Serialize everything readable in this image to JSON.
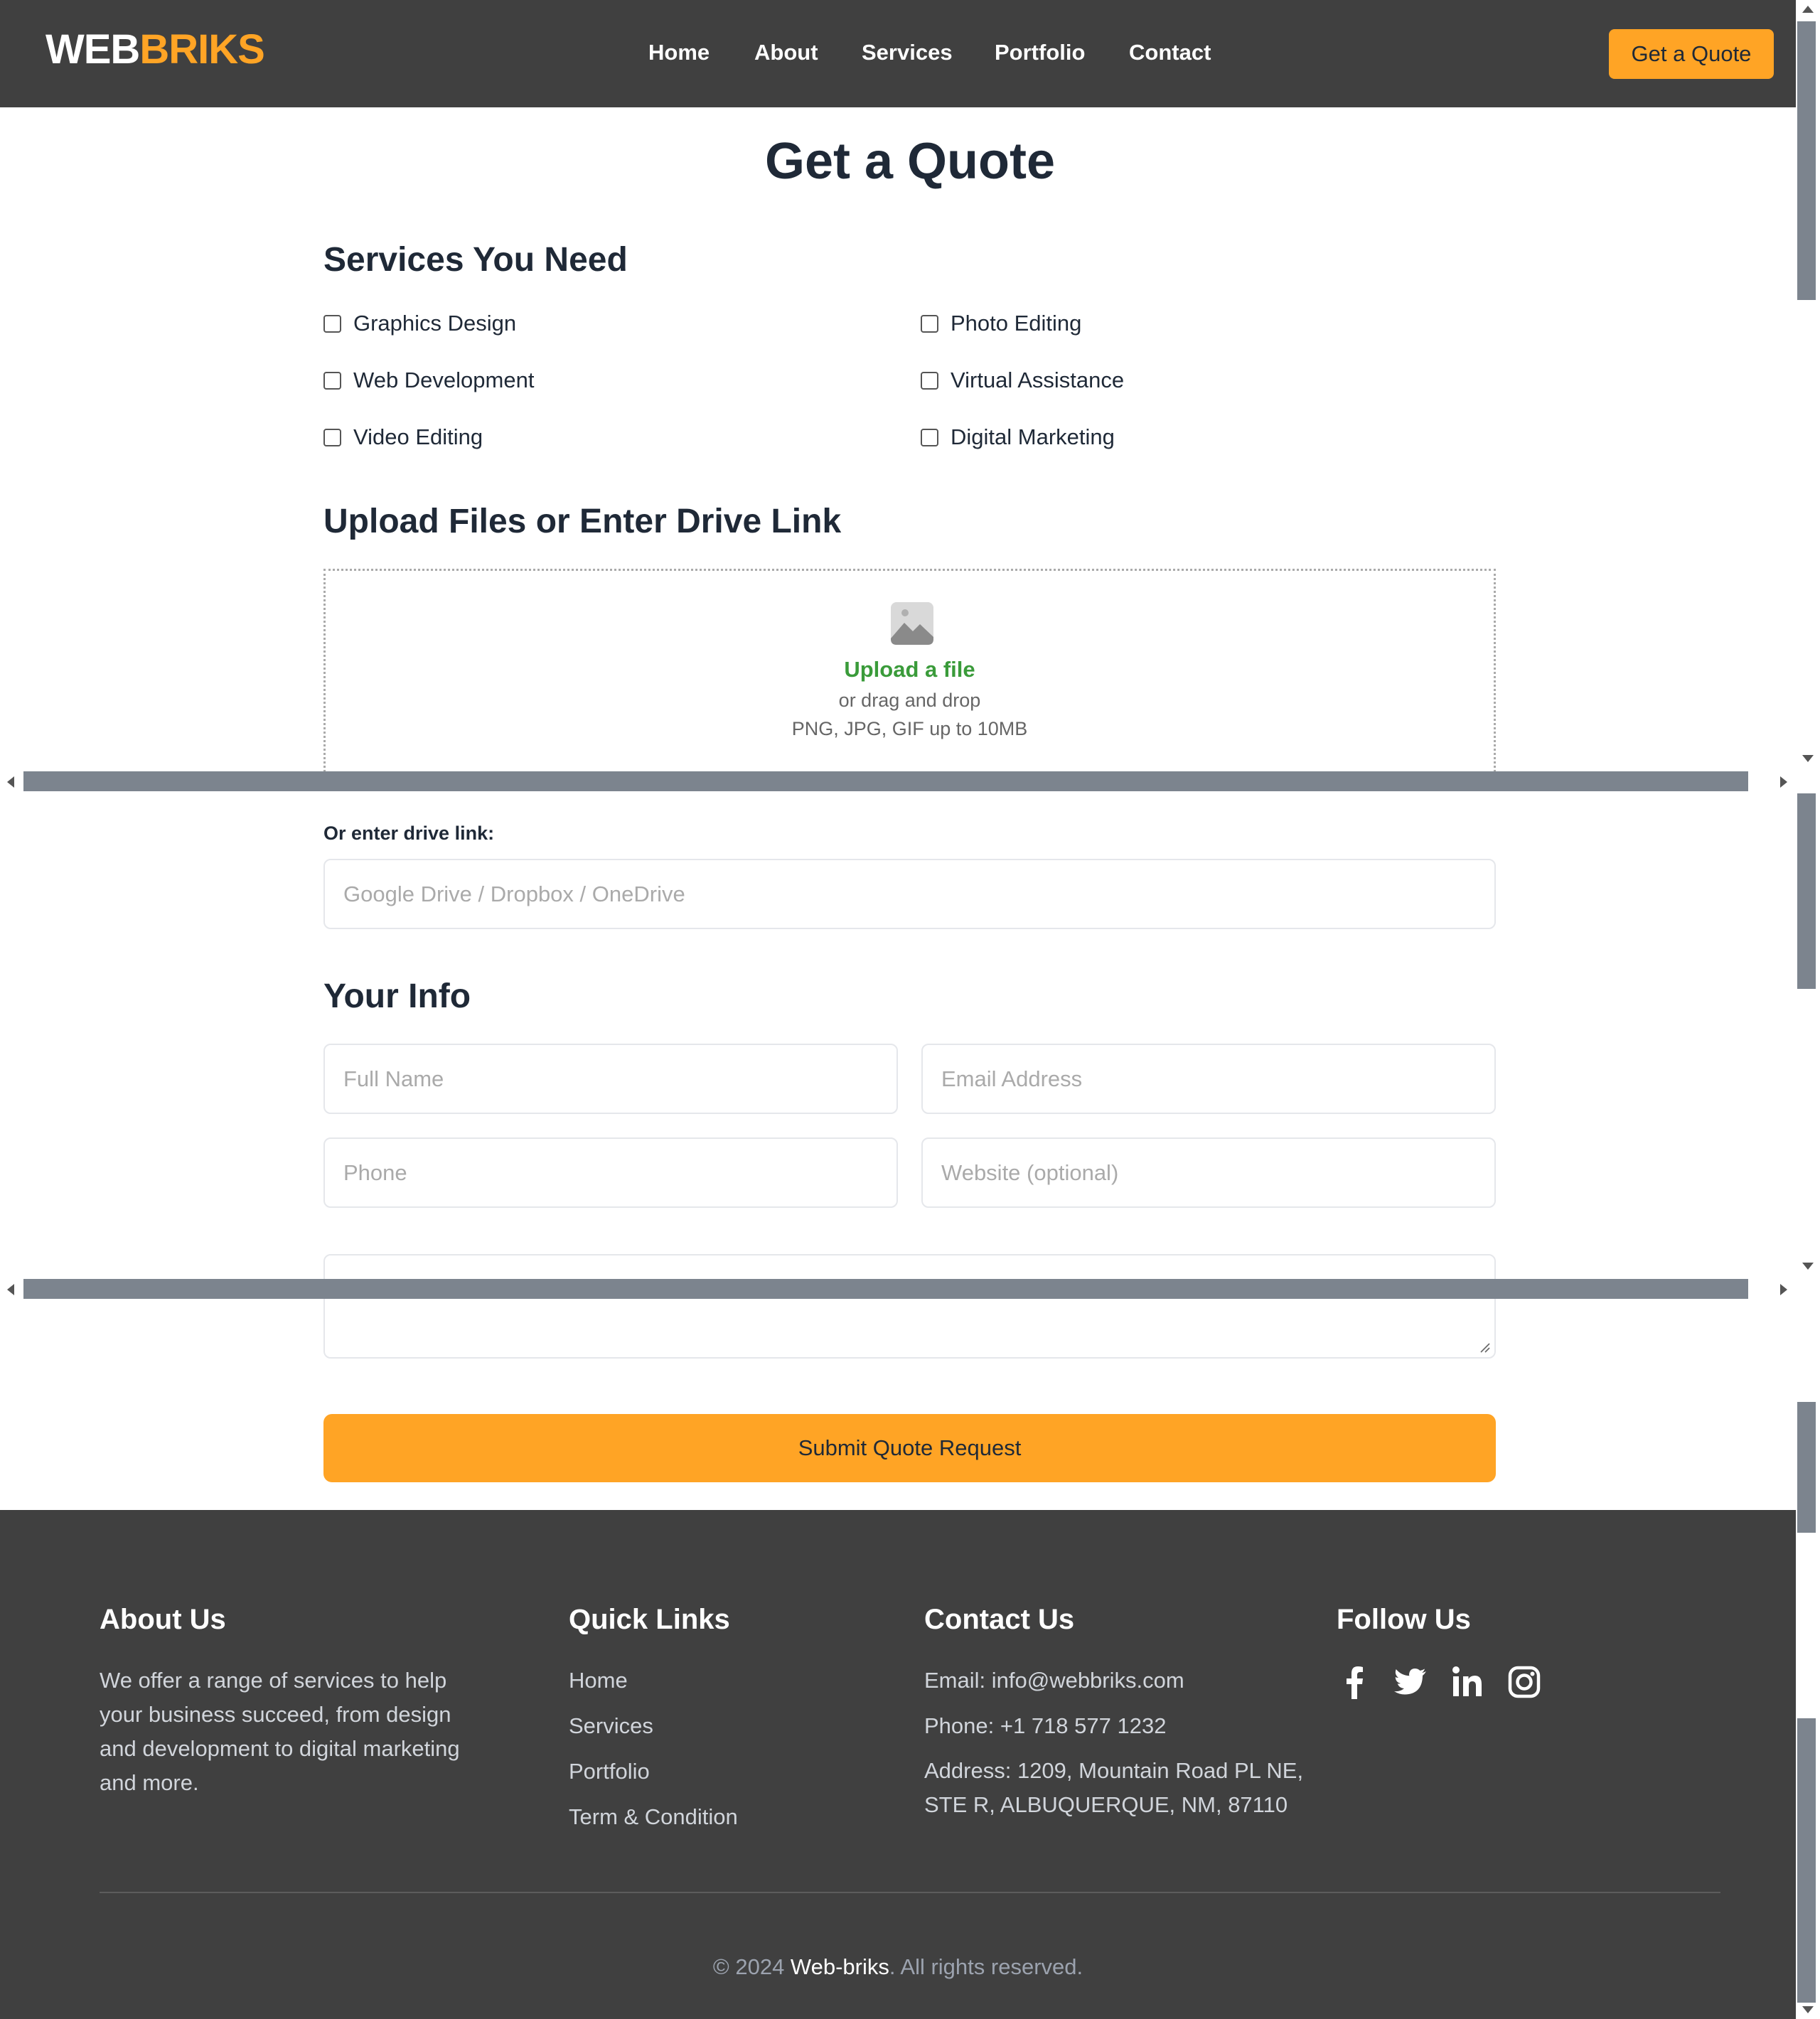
{
  "header": {
    "logo_part1": "WEB",
    "logo_part2": "BRIKS",
    "nav": [
      "Home",
      "About",
      "Services",
      "Portfolio",
      "Contact"
    ],
    "cta_label": "Get a Quote"
  },
  "main": {
    "title": "Get a Quote",
    "services_heading": "Services You Need",
    "services": [
      {
        "label": "Graphics Design",
        "checked": false
      },
      {
        "label": "Photo Editing",
        "checked": false
      },
      {
        "label": "Web Development",
        "checked": false
      },
      {
        "label": "Virtual Assistance",
        "checked": false
      },
      {
        "label": "Video Editing",
        "checked": false
      },
      {
        "label": "Digital Marketing",
        "checked": false
      }
    ],
    "upload_heading": "Upload Files or Enter Drive Link",
    "upload": {
      "icon": "image-icon",
      "title": "Upload a file",
      "subtitle": "or drag and drop",
      "formats": "PNG, JPG, GIF up to 10MB"
    },
    "drive_label": "Or enter drive link:",
    "drive_placeholder": "Google Drive / Dropbox / OneDrive",
    "info_heading": "Your Info",
    "fields": {
      "full_name": "Full Name",
      "email": "Email Address",
      "phone": "Phone",
      "website": "Website (optional)"
    },
    "submit_label": "Submit Quote Request"
  },
  "footer": {
    "about_heading": "About Us",
    "about_text": "We offer a range of services to help your business succeed, from design and development to digital marketing and more.",
    "links_heading": "Quick Links",
    "links": [
      "Home",
      "Services",
      "Portfolio",
      "Term & Condition"
    ],
    "contact_heading": "Contact Us",
    "email": "Email: info@webbriks.com",
    "phone": "Phone: +1 718 577 1232",
    "address": "Address: 1209, Mountain Road PL NE, STE R, ALBUQUERQUE, NM, 87110",
    "follow_heading": "Follow Us",
    "social_icons": [
      "facebook-icon",
      "twitter-icon",
      "linkedin-icon",
      "instagram-icon"
    ],
    "copyright_prefix": "© 2024 ",
    "copyright_brand": "Web-briks",
    "copyright_suffix": ". All rights reserved."
  },
  "colors": {
    "header_bg": "#404040",
    "accent": "#ffa425",
    "upload_green": "#3a9b3a",
    "scroll_thumb": "#7c848e"
  }
}
